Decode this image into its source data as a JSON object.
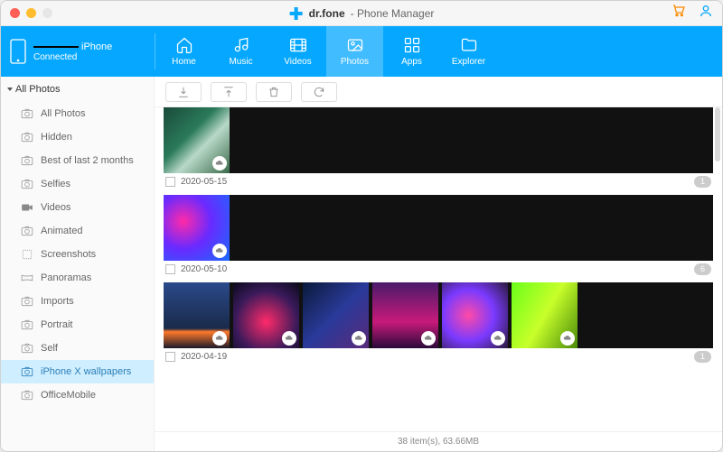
{
  "brand": {
    "name": "dr.fone",
    "suffix": "- Phone Manager"
  },
  "device": {
    "name": "iPhone",
    "status": "Connected"
  },
  "nav": [
    {
      "label": "Home"
    },
    {
      "label": "Music"
    },
    {
      "label": "Videos"
    },
    {
      "label": "Photos"
    },
    {
      "label": "Apps"
    },
    {
      "label": "Explorer"
    }
  ],
  "sidebar": {
    "header": "All Photos",
    "items": [
      {
        "label": "All Photos",
        "icon": "camera"
      },
      {
        "label": "Hidden",
        "icon": "camera"
      },
      {
        "label": "Best of last 2 months",
        "icon": "camera"
      },
      {
        "label": "Selfies",
        "icon": "camera"
      },
      {
        "label": "Videos",
        "icon": "video"
      },
      {
        "label": "Animated",
        "icon": "camera"
      },
      {
        "label": "Screenshots",
        "icon": "screenshot"
      },
      {
        "label": "Panoramas",
        "icon": "panorama"
      },
      {
        "label": "Imports",
        "icon": "camera"
      },
      {
        "label": "Portrait",
        "icon": "camera"
      },
      {
        "label": "Self",
        "icon": "camera"
      },
      {
        "label": "iPhone X wallpapers",
        "icon": "camera"
      },
      {
        "label": "OfficeMobile",
        "icon": "camera"
      }
    ],
    "selected": 11
  },
  "groups": [
    {
      "date": "2020-05-15",
      "count": "1",
      "thumbs": [
        "th-a"
      ]
    },
    {
      "date": "2020-05-10",
      "count": "6",
      "thumbs": [
        "th-b"
      ]
    },
    {
      "date": "2020-04-19",
      "count": "1",
      "thumbs": [
        "th-c0",
        "th-c1",
        "th-c2",
        "th-c3",
        "th-c4",
        "th-c5"
      ]
    }
  ],
  "status": "38 item(s), 63.66MB"
}
